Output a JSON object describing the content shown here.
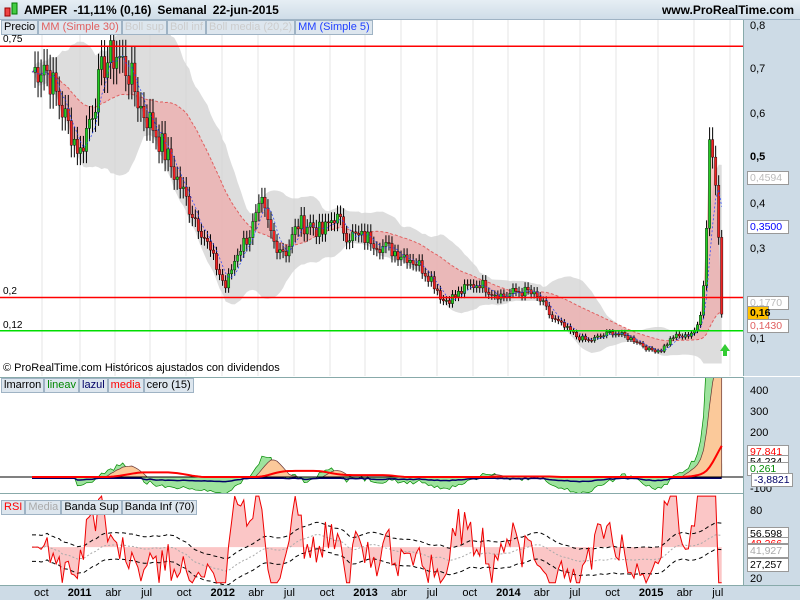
{
  "title": {
    "symbol": "AMPER",
    "change": "-11,11% (0,16)",
    "period": "Semanal",
    "date": "22-jun-2015",
    "site": "www.ProRealTime.com"
  },
  "price_legend": [
    "Precio",
    "MM (Simple 30)",
    "Boll sup",
    "Boll inf",
    "Boll media (20,2)",
    "MM (Simple 5)"
  ],
  "price_axis": {
    "ticks": [
      "0,8",
      "0,7",
      "0,6",
      "0,5",
      "0,4",
      "0,3",
      "0,2",
      "0,1"
    ],
    "boxes": {
      "boll_sup": "0,4594",
      "mm5": "0,3500",
      "boll_media": "0,1770",
      "last": "0,16",
      "mm30": "0,1430"
    }
  },
  "levels": [
    {
      "label": "0,75",
      "value": 0.757,
      "color": "#ff0000"
    },
    {
      "label": "0,2",
      "value": 0.197,
      "color": "#ff0000"
    },
    {
      "label": "0,12",
      "value": 0.123,
      "color": "#00dd00"
    }
  ],
  "watermark": "© ProRealTime.com  Históricos ajustados con dividendos",
  "ind_legend": [
    "lmarron",
    "lineav",
    "lazul",
    "media",
    "cero (15)"
  ],
  "ind_axis": {
    "ticks": [
      "400",
      "300",
      "200",
      "-100"
    ],
    "boxes": {
      "media": "97,841",
      "lmarron": "54,234",
      "lineav": "0,261",
      "lazul": "-3,8821"
    }
  },
  "rsi_legend": [
    "RSI",
    "Media",
    "Banda Sup",
    "Banda Inf (70)"
  ],
  "rsi_axis": {
    "ticks": [
      "80",
      "20"
    ],
    "boxes": {
      "sup": "56,598",
      "rsi": "48,266",
      "media": "41,927",
      "inf": "27,257"
    }
  },
  "time_axis": [
    [
      "oct",
      0
    ],
    [
      "2011",
      1
    ],
    [
      "abr",
      0
    ],
    [
      "jul",
      0
    ],
    [
      "oct",
      0
    ],
    [
      "2012",
      1
    ],
    [
      "abr",
      0
    ],
    [
      "jul",
      0
    ],
    [
      "oct",
      0
    ],
    [
      "2013",
      1
    ],
    [
      "abr",
      0
    ],
    [
      "jul",
      0
    ],
    [
      "oct",
      0
    ],
    [
      "2014",
      1
    ],
    [
      "abr",
      0
    ],
    [
      "jul",
      0
    ],
    [
      "oct",
      0
    ],
    [
      "2015",
      1
    ],
    [
      "abr",
      0
    ],
    [
      "jul",
      0
    ]
  ],
  "chart_data": {
    "type": "candlestick",
    "period": "weekly",
    "start": "2010-09",
    "monthly_close": [
      0.7,
      0.72,
      0.65,
      0.58,
      0.52,
      0.62,
      0.72,
      0.74,
      0.7,
      0.62,
      0.58,
      0.52,
      0.46,
      0.4,
      0.35,
      0.28,
      0.22,
      0.3,
      0.34,
      0.4,
      0.32,
      0.3,
      0.36,
      0.36,
      0.34,
      0.38,
      0.34,
      0.33,
      0.33,
      0.31,
      0.3,
      0.29,
      0.27,
      0.24,
      0.19,
      0.2,
      0.22,
      0.23,
      0.21,
      0.2,
      0.21,
      0.21,
      0.19,
      0.15,
      0.13,
      0.11,
      0.1,
      0.11,
      0.12,
      0.11,
      0.1,
      0.08,
      0.08,
      0.11,
      0.11,
      0.13,
      0.55,
      0.16
    ]
  }
}
